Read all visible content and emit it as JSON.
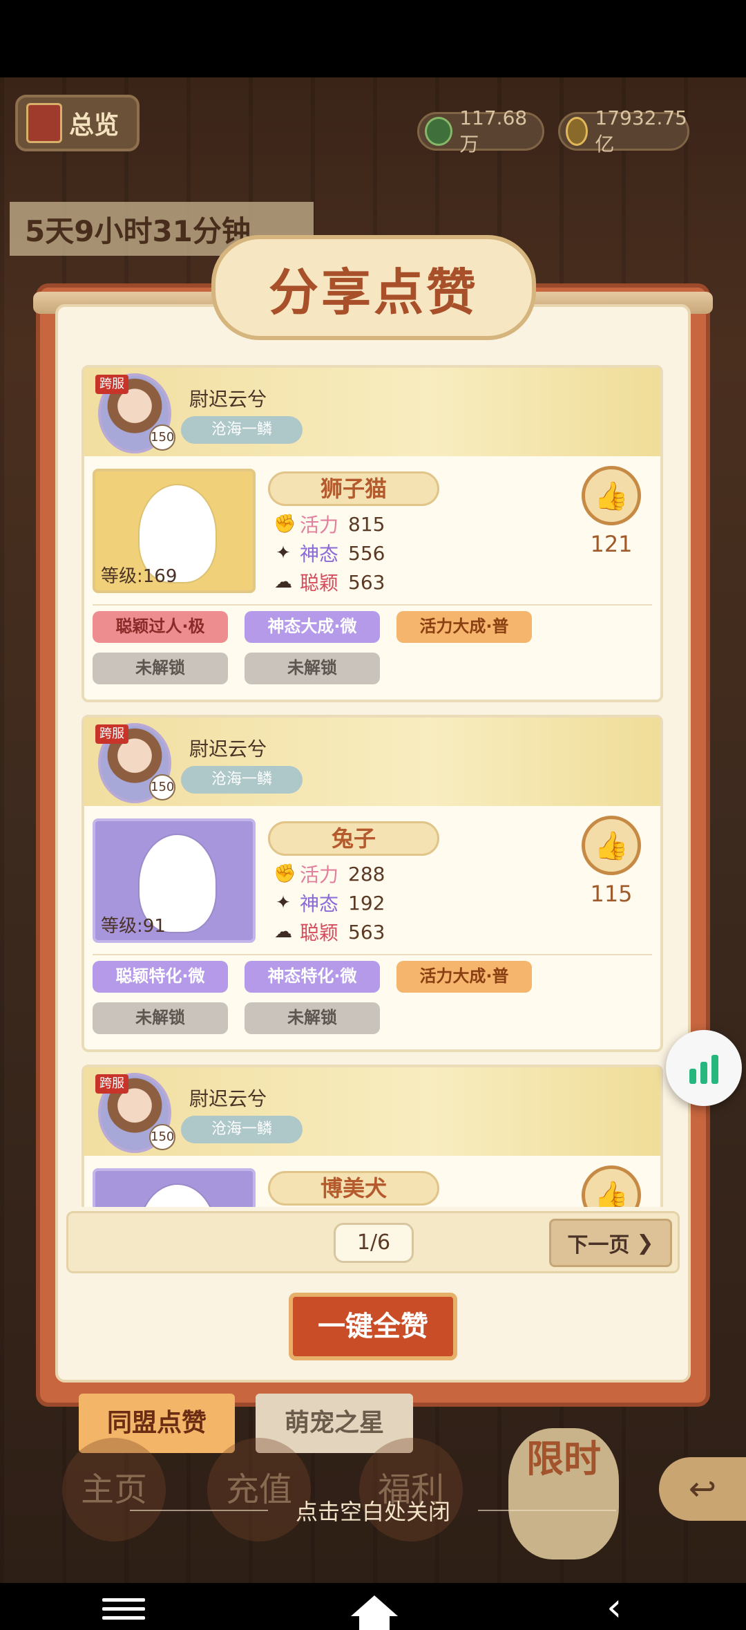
{
  "header": {
    "overview_label": "总览",
    "currency_a": "117.68万",
    "currency_b": "17932.75亿",
    "timer": "5天9小时31分钟"
  },
  "modal": {
    "title": "分享点赞",
    "cards": [
      {
        "tag": "跨服",
        "avatar_level": "150",
        "player_name": "尉迟云兮",
        "server": "沧海一鳞",
        "pet_name": "狮子猫",
        "pet_level": "等级:169",
        "stats": [
          {
            "label": "活力",
            "value": "815"
          },
          {
            "label": "神态",
            "value": "556"
          },
          {
            "label": "聪颖",
            "value": "563"
          }
        ],
        "likes": "121",
        "traits": [
          "聪颖过人·极",
          "神态大成·微",
          "活力大成·普"
        ],
        "locked": [
          "未解锁",
          "未解锁"
        ]
      },
      {
        "tag": "跨服",
        "avatar_level": "150",
        "player_name": "尉迟云兮",
        "server": "沧海一鳞",
        "pet_name": "兔子",
        "pet_level": "等级:91",
        "stats": [
          {
            "label": "活力",
            "value": "288"
          },
          {
            "label": "神态",
            "value": "192"
          },
          {
            "label": "聪颖",
            "value": "563"
          }
        ],
        "likes": "115",
        "traits": [
          "聪颖特化·微",
          "神态特化·微",
          "活力大成·普"
        ],
        "locked": [
          "未解锁",
          "未解锁"
        ]
      },
      {
        "tag": "跨服",
        "avatar_level": "150",
        "player_name": "尉迟云兮",
        "server": "沧海一鳞",
        "pet_name": "博美犬"
      }
    ],
    "pagination": {
      "page": "1/6",
      "next_label": "下一页"
    },
    "like_all_label": "一键全赞"
  },
  "tabs": [
    {
      "label": "同盟点赞",
      "active": true
    },
    {
      "label": "萌宠之星",
      "active": false
    }
  ],
  "bottom_nav": {
    "home": "主页",
    "recharge": "充值",
    "welfare": "福利",
    "limited": "限时"
  },
  "close_hint": "点击空白处关闭",
  "colors": {
    "accent": "#c94e28",
    "panel": "#c7663f",
    "float_ball": "#26b77e"
  }
}
